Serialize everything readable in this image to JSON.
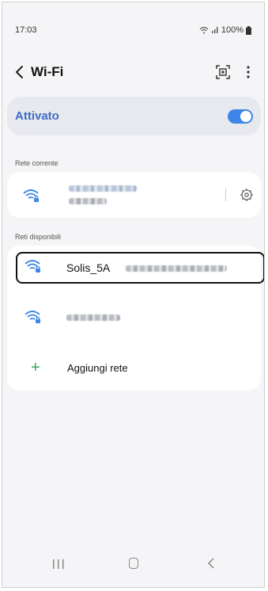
{
  "status_bar": {
    "time": "17:03",
    "battery": "100%"
  },
  "header": {
    "title": "Wi-Fi"
  },
  "master": {
    "label": "Attivato"
  },
  "current": {
    "section_label": "Rete corrente"
  },
  "available": {
    "section_label": "Reti disponibili",
    "networks": [
      {
        "name": "Solis_5A"
      }
    ],
    "add_label": "Aggiungi rete"
  },
  "colors": {
    "accent": "#3d86e8",
    "title_blue": "#3e6bc6",
    "add_green": "#3aa55a"
  }
}
